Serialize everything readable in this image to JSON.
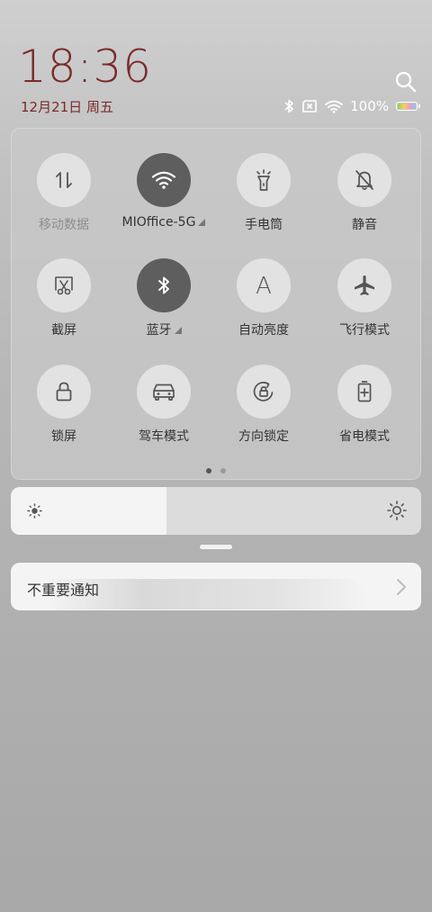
{
  "clock": {
    "time": "18:36",
    "date": "12月21日 周五"
  },
  "status": {
    "battery_text": "100%"
  },
  "toggles": [
    {
      "label": "移动数据",
      "icon": "mobile-data-icon",
      "on": false,
      "dim": true
    },
    {
      "label": "MIOffice-5G",
      "icon": "wifi-icon",
      "on": true,
      "dim": false
    },
    {
      "label": "手电筒",
      "icon": "flashlight-icon",
      "on": false,
      "dim": false
    },
    {
      "label": "静音",
      "icon": "mute-bell-icon",
      "on": false,
      "dim": false
    },
    {
      "label": "截屏",
      "icon": "screenshot-icon",
      "on": false,
      "dim": false
    },
    {
      "label": "蓝牙",
      "icon": "bluetooth-icon",
      "on": true,
      "dim": false
    },
    {
      "label": "自动亮度",
      "icon": "auto-brightness-icon",
      "on": false,
      "dim": false
    },
    {
      "label": "飞行模式",
      "icon": "airplane-icon",
      "on": false,
      "dim": false
    },
    {
      "label": "锁屏",
      "icon": "lock-icon",
      "on": false,
      "dim": false
    },
    {
      "label": "驾车模式",
      "icon": "car-icon",
      "on": false,
      "dim": false
    },
    {
      "label": "方向锁定",
      "icon": "rotation-lock-icon",
      "on": false,
      "dim": false
    },
    {
      "label": "省电模式",
      "icon": "battery-saver-icon",
      "on": false,
      "dim": false
    }
  ],
  "pager": {
    "pages": 2,
    "current": 1
  },
  "brightness": {
    "level": 0.38
  },
  "notification": {
    "text": "不重要通知"
  },
  "colors": {
    "clock": "#7a2a2a",
    "toggle_on": "#5e5e5e",
    "toggle_off": "#e2e2e2"
  }
}
